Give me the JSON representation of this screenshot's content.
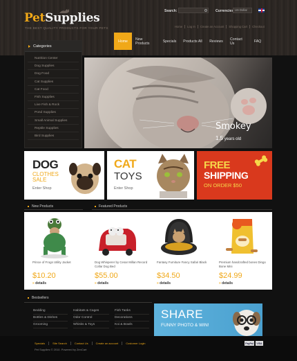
{
  "header": {
    "logo_a": "Pet",
    "logo_b": "Supplies",
    "tagline": "THE BEST QUALITY PRODUCTS FOR YOUR PETS",
    "search_label": "Search:",
    "currencies_label": "Currencies:",
    "currency_value": "US Dollar",
    "top_links": [
      "Home",
      "Log In",
      "Create an Account",
      "Shopping Cart",
      "Checkout"
    ]
  },
  "nav": [
    "Home",
    "New Products",
    "Specials",
    "Products All",
    "Reviews",
    "Contact Us",
    "FAQ"
  ],
  "sidebar": {
    "title": "Categories",
    "items": [
      "Nutrition Center",
      "Dog Supplies",
      "Dog Food",
      "Cat Supplies",
      "Cat Food",
      "Fish Supplies",
      "Live Fish & Rock",
      "Pond Supplies",
      "Small Animal Supplies",
      "Reptile Supplies",
      "Bird Supplies"
    ]
  },
  "hero": {
    "name": "Smokey",
    "age_num": "1.5",
    "age_text": " years old"
  },
  "banners": {
    "dog": {
      "title": "DOG",
      "line1": "CLOTHES",
      "line2": "SALE",
      "enter": "Enter Shop"
    },
    "cat": {
      "title": "CAT",
      "line2": "TOYS",
      "enter": "Enter Shop"
    },
    "ship": {
      "line1": "FREE",
      "line2": "SHIPPING",
      "line3": "ON ORDER $50"
    }
  },
  "sections": {
    "new": "New Products",
    "featured": "Featured Products",
    "best": "Bestsellers"
  },
  "products": [
    {
      "name": "Prince of Frogs Utility Jacket",
      "price": "$10.20",
      "details": "details"
    },
    {
      "name": "Dog Whisperer by Cesar Millan Record Collar Dog Bed",
      "price": "$55.00",
      "details": "details"
    },
    {
      "name": "Fantasy Furniture Fancy Safari Black",
      "price": "$34.50",
      "details": "details"
    },
    {
      "name": "Premium handcrafted bones Dingo Bone Mini",
      "price": "$24.99",
      "details": "details"
    }
  ],
  "bestsellers": [
    [
      "Bedding",
      "Bottles & Dishes",
      "Grooming"
    ],
    [
      "Habitats & Cages",
      "Odor Control",
      "Whisks & Toys"
    ],
    [
      "Fish Tanks",
      "Decorations",
      "Koi & Bowls"
    ]
  ],
  "share": {
    "title": "SHARE",
    "subtitle": "FUNNY PHOTO & WIN!"
  },
  "footer": {
    "links": [
      "Specials",
      "Site Search",
      "Contact Us",
      "Create an account",
      "Customer Login"
    ],
    "copyright": "Pet Supplies © 2010. Powered by ZenCart",
    "pay1": "PayPal",
    "pay2": "VISA"
  },
  "colors": {
    "accent": "#f0a818",
    "shipping_red": "#d9391d",
    "share_blue": "#5fb3dd"
  }
}
